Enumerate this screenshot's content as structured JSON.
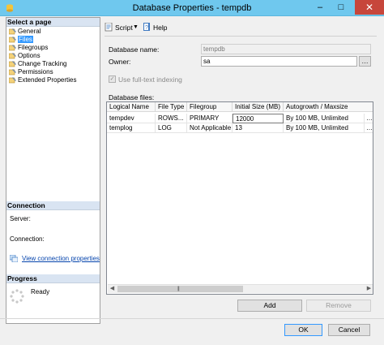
{
  "window": {
    "title": "Database Properties - tempdb",
    "minimize": "–",
    "maximize": "□",
    "close": "✕"
  },
  "left": {
    "select_page_header": "Select a page",
    "pages": [
      {
        "label": "General"
      },
      {
        "label": "Files"
      },
      {
        "label": "Filegroups"
      },
      {
        "label": "Options"
      },
      {
        "label": "Change Tracking"
      },
      {
        "label": "Permissions"
      },
      {
        "label": "Extended Properties"
      }
    ],
    "selected_page": "Files",
    "connection_header": "Connection",
    "server_label": "Server:",
    "connection_label": "Connection:",
    "view_connection_link": "View connection properties",
    "progress_header": "Progress",
    "progress_status": "Ready"
  },
  "toolbar": {
    "script_label": "Script",
    "help_label": "Help"
  },
  "form": {
    "database_name_label": "Database name:",
    "database_name_value": "tempdb",
    "owner_label": "Owner:",
    "owner_value": "sa",
    "fulltext_label": "Use full-text indexing",
    "fulltext_checked": true,
    "database_files_label": "Database files:"
  },
  "grid": {
    "columns": [
      "Logical Name",
      "File Type",
      "Filegroup",
      "Initial Size (MB)",
      "Autogrowth / Maxsize"
    ],
    "rows": [
      [
        "tempdev",
        "ROWS...",
        "PRIMARY",
        "12000",
        "By 100 MB, Unlimited"
      ],
      [
        "templog",
        "LOG",
        "Not Applicable",
        "13",
        "By 100 MB, Unlimited"
      ]
    ]
  },
  "buttons": {
    "add": "Add",
    "remove": "Remove",
    "ok": "OK",
    "cancel": "Cancel"
  },
  "colors": {
    "titlebar": "#6fc8ee",
    "selection": "#3399ff",
    "close_button": "#c7463b",
    "link": "#0645ad"
  }
}
